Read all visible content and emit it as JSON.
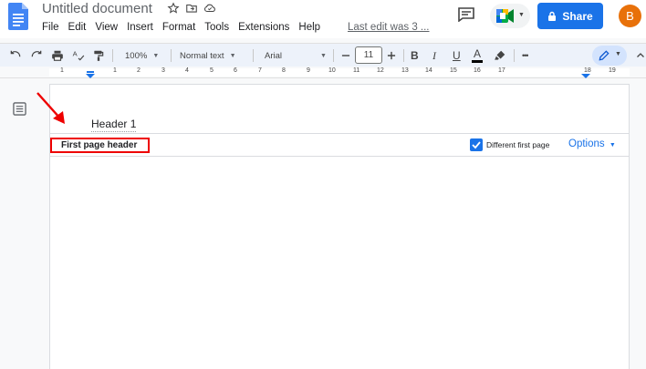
{
  "app": {
    "doc_title": "Untitled document",
    "menu": [
      "File",
      "Edit",
      "View",
      "Insert",
      "Format",
      "Tools",
      "Extensions",
      "Help"
    ],
    "last_edit": "Last edit was 3 ...",
    "share_label": "Share",
    "avatar_letter": "B"
  },
  "toolbar": {
    "zoom": "100%",
    "style": "Normal text",
    "font": "Arial",
    "font_size": "11",
    "bold": "B",
    "italic": "I",
    "underline": "U",
    "text_color": "A",
    "more": "•••"
  },
  "ruler": {
    "numbers": [
      "1",
      "1",
      "2",
      "3",
      "4",
      "5",
      "6",
      "7",
      "8",
      "9",
      "10",
      "11",
      "12",
      "13",
      "14",
      "15",
      "16",
      "17",
      "18",
      "19"
    ]
  },
  "document": {
    "header_text": "Header 1",
    "header_label": "First page header",
    "different_first_page": "Different first page",
    "options_label": "Options"
  },
  "colors": {
    "accent": "#1a73e8",
    "annotation": "#e00000",
    "avatar": "#e8710a"
  }
}
